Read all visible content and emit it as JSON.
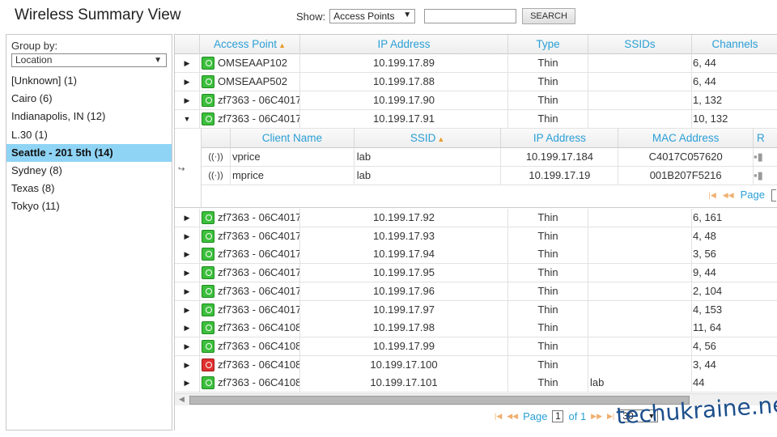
{
  "header": {
    "title": "Wireless Summary View",
    "show_label": "Show:",
    "show_value": "Access Points",
    "search_value": "",
    "search_button": "SEARCH"
  },
  "sidebar": {
    "group_by_label": "Group by:",
    "group_by_value": "Location",
    "items": [
      {
        "label": "[Unknown] (1)"
      },
      {
        "label": "Cairo (6)"
      },
      {
        "label": "Indianapolis, IN (12)"
      },
      {
        "label": "L.30 (1)"
      },
      {
        "label": "Seattle - 201 5th (14)",
        "selected": true
      },
      {
        "label": "Sydney (8)"
      },
      {
        "label": "Texas (8)"
      },
      {
        "label": "Tokyo (11)"
      }
    ]
  },
  "grid": {
    "columns": [
      "Access Point",
      "IP Address",
      "Type",
      "SSIDs",
      "Channels"
    ],
    "rows_top": [
      {
        "ap": "OMSEAAP102",
        "ip": "10.199.17.89",
        "type": "Thin",
        "ssids": "",
        "channels": "6, 44",
        "status": "green",
        "expanded": false
      },
      {
        "ap": "OMSEAAP502",
        "ip": "10.199.17.88",
        "type": "Thin",
        "ssids": "",
        "channels": "6, 44",
        "status": "green",
        "expanded": false
      },
      {
        "ap": "zf7363 - 06C4017",
        "ip": "10.199.17.90",
        "type": "Thin",
        "ssids": "",
        "channels": "1, 132",
        "status": "green",
        "expanded": false
      },
      {
        "ap": "zf7363 - 06C4017",
        "ip": "10.199.17.91",
        "type": "Thin",
        "ssids": "",
        "channels": "10, 132",
        "status": "green",
        "expanded": true
      }
    ],
    "clients": {
      "columns": [
        "Client Name",
        "SSID",
        "IP Address",
        "MAC Address",
        "R"
      ],
      "rows": [
        {
          "name": "vprice",
          "ssid": "lab",
          "ip": "10.199.17.184",
          "mac": "C4017C057620"
        },
        {
          "name": "mprice",
          "ssid": "lab",
          "ip": "10.199.17.19",
          "mac": "001B207F5216"
        }
      ],
      "pager_label": "Page"
    },
    "rows_bottom": [
      {
        "ap": "zf7363 - 06C4017",
        "ip": "10.199.17.92",
        "type": "Thin",
        "ssids": "",
        "channels": "6, 161",
        "status": "green"
      },
      {
        "ap": "zf7363 - 06C4017",
        "ip": "10.199.17.93",
        "type": "Thin",
        "ssids": "",
        "channels": "4, 48",
        "status": "green"
      },
      {
        "ap": "zf7363 - 06C4017",
        "ip": "10.199.17.94",
        "type": "Thin",
        "ssids": "",
        "channels": "3, 56",
        "status": "green"
      },
      {
        "ap": "zf7363 - 06C4017",
        "ip": "10.199.17.95",
        "type": "Thin",
        "ssids": "",
        "channels": "9, 44",
        "status": "green"
      },
      {
        "ap": "zf7363 - 06C4017",
        "ip": "10.199.17.96",
        "type": "Thin",
        "ssids": "",
        "channels": "2, 104",
        "status": "green"
      },
      {
        "ap": "zf7363 - 06C4017",
        "ip": "10.199.17.97",
        "type": "Thin",
        "ssids": "",
        "channels": "4, 153",
        "status": "green"
      },
      {
        "ap": "zf7363 - 06C4108",
        "ip": "10.199.17.98",
        "type": "Thin",
        "ssids": "",
        "channels": "11, 64",
        "status": "green"
      },
      {
        "ap": "zf7363 - 06C4108",
        "ip": "10.199.17.99",
        "type": "Thin",
        "ssids": "",
        "channels": "4, 56",
        "status": "green"
      },
      {
        "ap": "zf7363 - 06C4108",
        "ip": "10.199.17.100",
        "type": "Thin",
        "ssids": "",
        "channels": "3, 44",
        "status": "red"
      },
      {
        "ap": "zf7363 - 06C4108",
        "ip": "10.199.17.101",
        "type": "Thin",
        "ssids": "lab",
        "channels": "44",
        "status": "green"
      }
    ]
  },
  "pager": {
    "page_label": "Page",
    "page_value": "1",
    "of_label": "of 1",
    "page_size": "30"
  },
  "watermark": "techukraine.net",
  "icons": {
    "expand": "triangle-right",
    "collapse": "triangle-down",
    "ap_status": "wifi-ap-icon",
    "client": "wifi-signal-icon"
  },
  "colors": {
    "accent": "#2a9fd6",
    "selected": "#8fd4f5",
    "status_green": "#3cbf3c",
    "status_red": "#e03030",
    "sort_arrow": "#e89b2a"
  }
}
